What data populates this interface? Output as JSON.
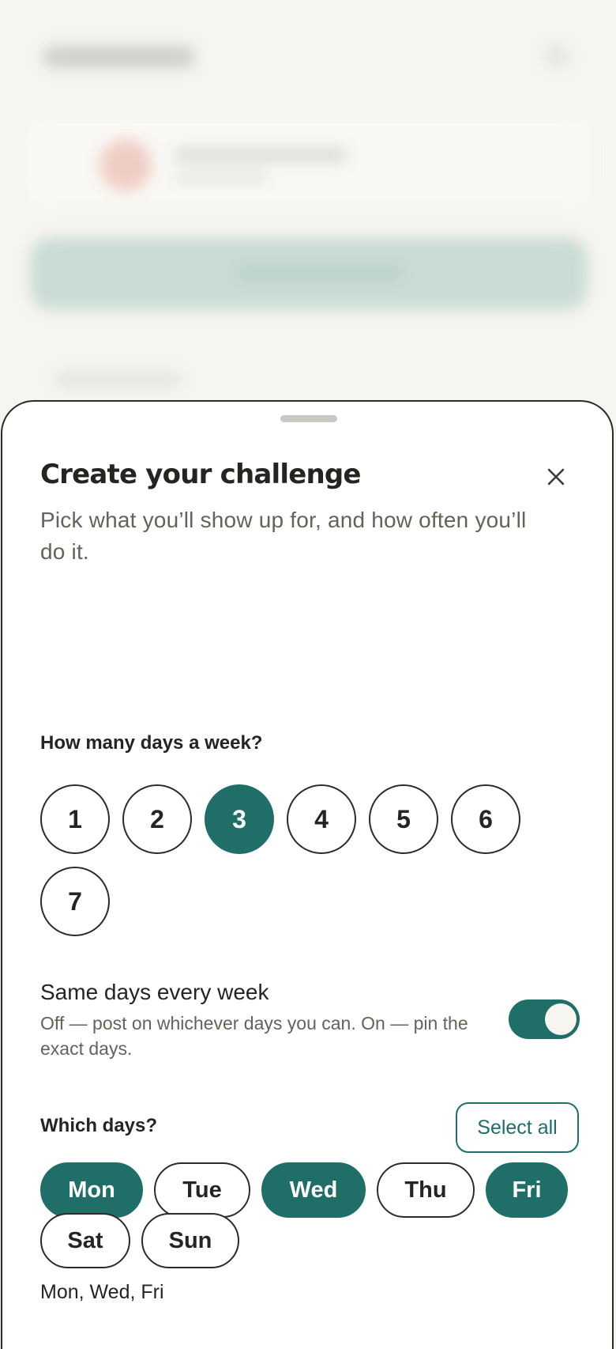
{
  "sheet": {
    "title": "Create your challenge",
    "subtitle": "Pick what you’ll show up for, and how often you’ll do it.",
    "close_icon": "close-icon"
  },
  "frequency": {
    "question": "How many days a week?",
    "options": [
      "1",
      "2",
      "3",
      "4",
      "5",
      "6",
      "7"
    ],
    "selected": "3"
  },
  "same_days": {
    "title": "Same days every week",
    "description": "Off — post on whichever days you can. On — pin the exact days.",
    "enabled": true
  },
  "which_days": {
    "question": "Which days?",
    "select_all_label": "Select all",
    "days": [
      {
        "label": "Mon",
        "selected": true
      },
      {
        "label": "Tue",
        "selected": false
      },
      {
        "label": "Wed",
        "selected": true
      },
      {
        "label": "Thu",
        "selected": false
      },
      {
        "label": "Fri",
        "selected": true
      },
      {
        "label": "Sat",
        "selected": false
      },
      {
        "label": "Sun",
        "selected": false
      }
    ],
    "summary": "Mon, Wed, Fri"
  },
  "colors": {
    "accent": "#1f6e68",
    "text": "#242421",
    "muted": "#656258",
    "background": "#f7f5f0"
  }
}
